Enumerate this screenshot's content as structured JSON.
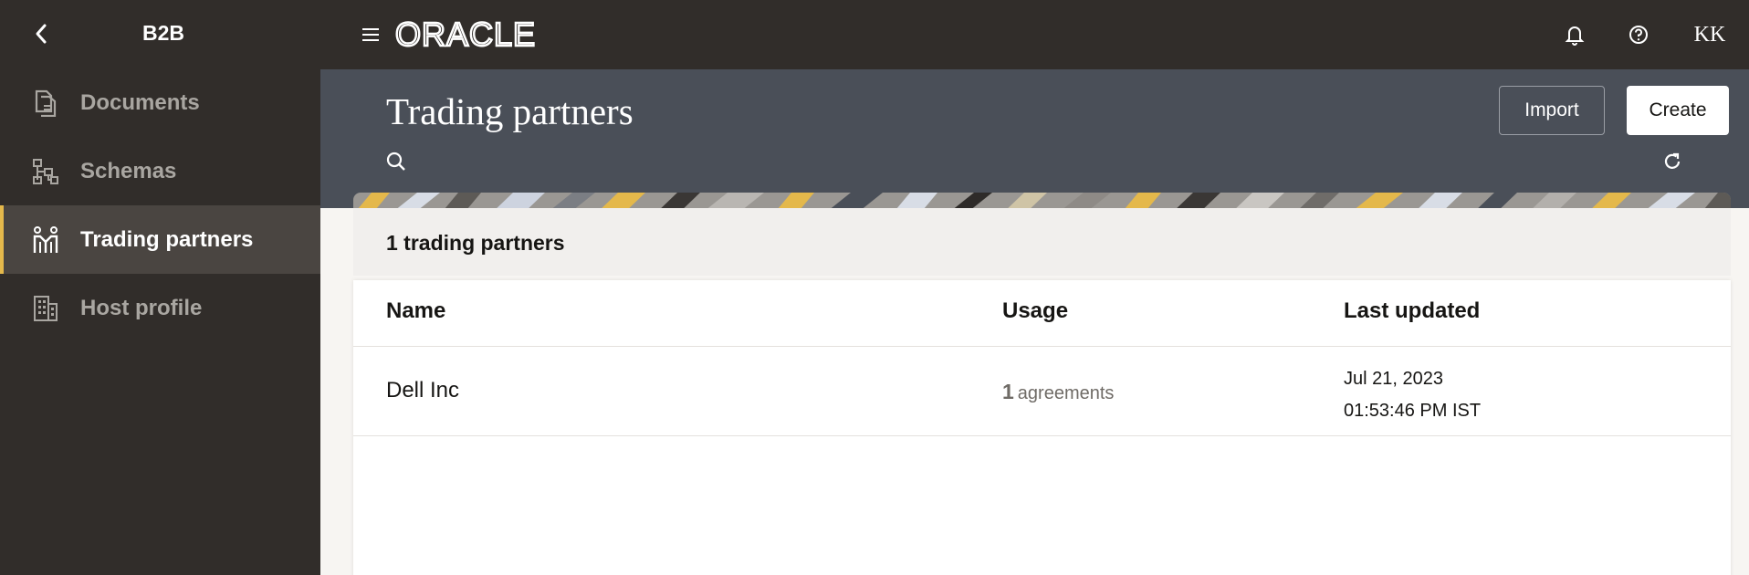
{
  "sidebar": {
    "title": "B2B",
    "items": [
      {
        "label": "Documents",
        "icon": "document-icon"
      },
      {
        "label": "Schemas",
        "icon": "schema-icon"
      },
      {
        "label": "Trading partners",
        "icon": "trading-partners-icon",
        "active": true
      },
      {
        "label": "Host profile",
        "icon": "building-icon"
      }
    ]
  },
  "topbar": {
    "logo": "ORACLE",
    "avatar": "KK"
  },
  "page": {
    "title": "Trading partners",
    "import_label": "Import",
    "create_label": "Create",
    "count_label": "1 trading partners"
  },
  "table": {
    "columns": [
      "Name",
      "Usage",
      "Last updated"
    ],
    "rows": [
      {
        "name": "Dell Inc",
        "usage_count": "1",
        "usage_unit": "agreements",
        "updated_date": "Jul 21, 2023",
        "updated_time": "01:53:46 PM IST"
      }
    ]
  },
  "colors": {
    "sidebar_bg": "#312d2a",
    "header_bg": "#4a4f58",
    "active_accent": "#e4b84b",
    "active_bg": "#4a4541"
  }
}
